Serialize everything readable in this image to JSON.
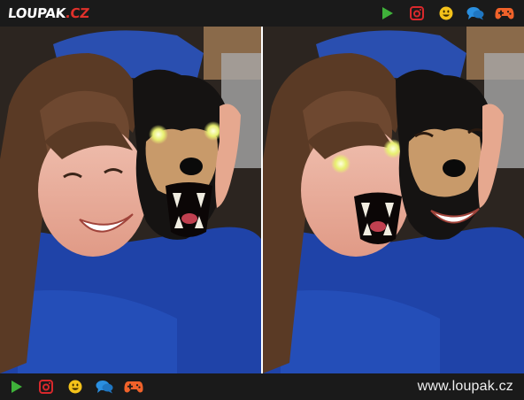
{
  "header": {
    "logo_main": "LOUPAK",
    "logo_dot": ".",
    "logo_cz": "CZ",
    "icons": [
      "play-icon",
      "instagram-icon",
      "smiley-icon",
      "chat-icon",
      "gamepad-icon"
    ]
  },
  "footer": {
    "site_url": "www.loupak.cz",
    "icons": [
      "play-icon",
      "instagram-icon",
      "smiley-icon",
      "chat-icon",
      "gamepad-icon"
    ]
  },
  "colors": {
    "bar_background": "#1a1a1a",
    "brand_red": "#e0312b",
    "play_green": "#3fb23a",
    "instagram_red": "#d8282c",
    "smiley_yellow": "#f4c21a",
    "chat_blue": "#2a8fe0",
    "gamepad_orange": "#f0622a"
  },
  "image": {
    "left_panel": "girl smiling with dog, dog has glowing eyes and fangs",
    "right_panel": "faces swapped, girl with glowing eyes and fangs, dog smiling"
  }
}
